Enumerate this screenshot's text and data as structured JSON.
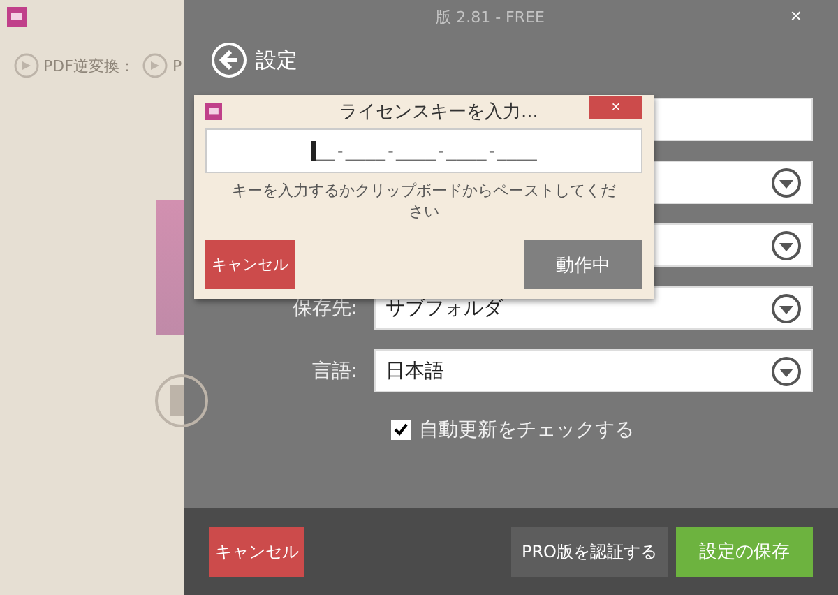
{
  "background_app": {
    "toolbar": [
      {
        "label": "PDF逆変換："
      },
      {
        "label": "P"
      }
    ]
  },
  "window": {
    "title": "版 2.81 - FREE",
    "close": "×"
  },
  "settings": {
    "title": "設定",
    "rows": [
      {
        "kind": "text"
      },
      {
        "kind": "dropdown"
      },
      {
        "kind": "dropdown"
      },
      {
        "kind": "dropdown",
        "label": "保存先:",
        "value": "サブフォルダ"
      },
      {
        "kind": "dropdown",
        "label": "言語:",
        "value": "日本語"
      },
      {
        "kind": "checkbox",
        "label": "自動更新をチェックする",
        "checked": true
      }
    ],
    "buttons": [
      {
        "kind": "cancel",
        "label": "キャンセル"
      },
      {
        "kind": "secondary",
        "label": "PRO版を認証する"
      },
      {
        "kind": "primary",
        "label": "設定の保存"
      }
    ]
  },
  "dialog": {
    "title": "ライセンスキーを入力...",
    "close": "×",
    "key_value": "__-____-____-____-____",
    "hint": "キーを入力するかクリップボードからペーストしてください",
    "buttons": [
      {
        "kind": "cancel",
        "label": "キャンセル"
      },
      {
        "kind": "secondary",
        "label": "動作中"
      }
    ]
  }
}
